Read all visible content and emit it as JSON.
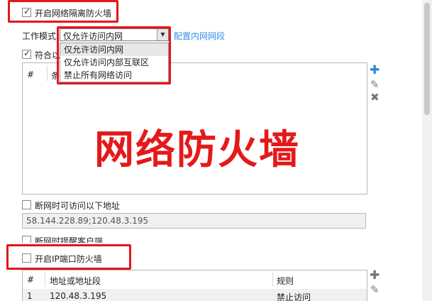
{
  "firewall": {
    "enable_label": "开启网络隔离防火墙",
    "mode_label": "工作模式",
    "mode_value": "仅允许访问内网",
    "mode_options": [
      "仅允许访问内网",
      "仅允许访问内部互联区",
      "禁止所有网络访问"
    ],
    "config_link": "配置内网网段",
    "match_label": "符合以",
    "rules_table": {
      "columns": [
        "#",
        "条"
      ]
    },
    "overlay_text": "网络防火墙",
    "offline_label": "断网时可访问以下地址",
    "offline_addresses": "58.144.228.89;120.48.3.195",
    "remind_label": "断网时提醒客户端"
  },
  "ip_port_firewall": {
    "enable_label": "开启IP端口防火墙",
    "table": {
      "columns": [
        "#",
        "地址或地址段",
        "规则"
      ],
      "rows": [
        {
          "index": "1",
          "address": "120.48.3.195",
          "rule": "禁止访问"
        }
      ]
    }
  },
  "toolbar_icons": [
    "plus-icon",
    "edit-icon",
    "delete-icon"
  ],
  "colors": {
    "highlight_red": "#e4161d",
    "link_blue": "#3a8ee6",
    "add_icon_blue": "#2b8ad8"
  }
}
